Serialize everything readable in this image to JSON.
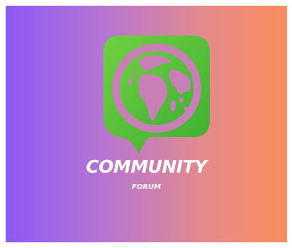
{
  "logo": {
    "title": "COMMUNITY",
    "subtitle": "FORUM",
    "icon": "speech-bubble-globe-icon"
  },
  "colors": {
    "gradient_start": "#8c59f5",
    "gradient_mid": "#e38a8d",
    "gradient_end": "#fb8d5a",
    "icon_green": "#5ec53a",
    "text": "#ffffff"
  }
}
